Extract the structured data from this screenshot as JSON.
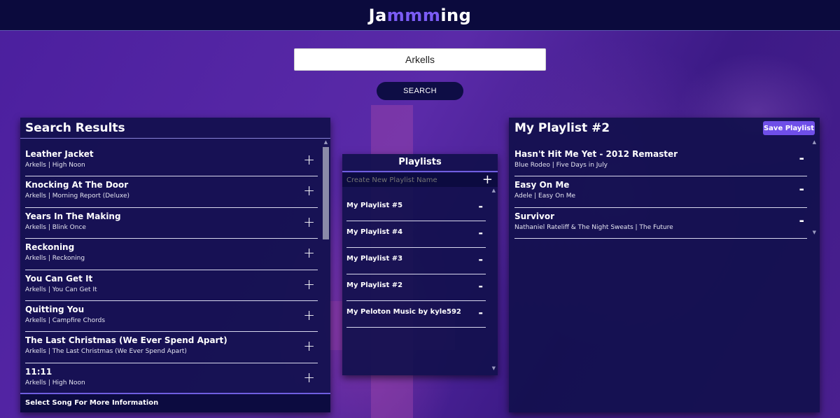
{
  "app": {
    "logo_prefix": "Ja",
    "logo_accent": "mmm",
    "logo_suffix": "ing",
    "accent_color": "#7b5cf5"
  },
  "search": {
    "value": "Arkells",
    "button_label": "SEARCH"
  },
  "results": {
    "title": "Search Results",
    "footer": "Select Song For More Information",
    "add_symbol": "+",
    "tracks": [
      {
        "name": "Leather Jacket",
        "meta": "Arkells | High Noon"
      },
      {
        "name": "Knocking At The Door",
        "meta": "Arkells | Morning Report (Deluxe)"
      },
      {
        "name": "Years In The Making",
        "meta": "Arkells | Blink Once"
      },
      {
        "name": "Reckoning",
        "meta": "Arkells | Reckoning"
      },
      {
        "name": "You Can Get It",
        "meta": "Arkells | You Can Get It"
      },
      {
        "name": "Quitting You",
        "meta": "Arkells | Campfire Chords"
      },
      {
        "name": "The Last Christmas (We Ever Spend Apart)",
        "meta": "Arkells | The Last Christmas (We Ever Spend Apart)"
      },
      {
        "name": "11:11",
        "meta": "Arkells | High Noon"
      }
    ]
  },
  "playlists": {
    "title": "Playlists",
    "create_placeholder": "Create New Playlist Name",
    "add_symbol": "+",
    "remove_symbol": "-",
    "items": [
      "My Playlist #5",
      "My Playlist #4",
      "My Playlist #3",
      "My Playlist #2",
      "My Peloton Music by kyle592"
    ]
  },
  "current": {
    "title": "My Playlist #2",
    "save_label": "Save Playlist",
    "remove_symbol": "-",
    "tracks": [
      {
        "name": "Hasn't Hit Me Yet - 2012 Remaster",
        "meta": "Blue Rodeo | Five Days in July"
      },
      {
        "name": "Easy On Me",
        "meta": "Adele | Easy On Me"
      },
      {
        "name": "Survivor",
        "meta": "Nathaniel Rateliff & The Night Sweats | The Future"
      }
    ]
  }
}
